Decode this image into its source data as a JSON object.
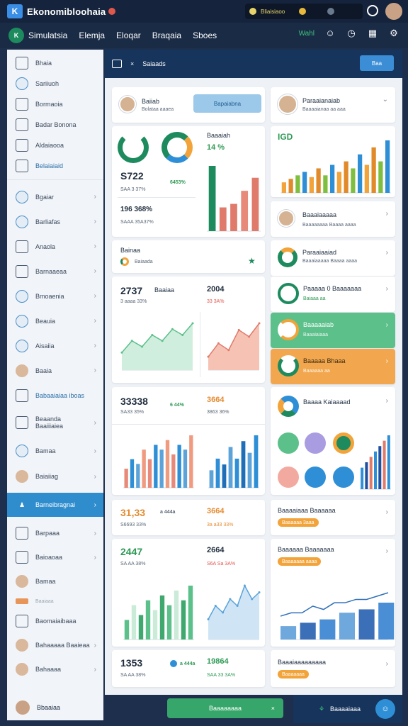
{
  "app": {
    "title": "Ekonomibloohaia",
    "status_text": "Bliaisiaoo"
  },
  "nav": {
    "logo_letter": "K",
    "items": [
      "Simulatsia",
      "Elemja",
      "Eloqar",
      "Braqaia",
      "Sboes"
    ],
    "right_label": "Wahl"
  },
  "sidebar": {
    "items": [
      {
        "label": "Bhaia",
        "icon": "chart-icon"
      },
      {
        "label": "Sariiuoh",
        "icon": "globe-icon"
      },
      {
        "label": "Bormaoia",
        "icon": "pen-icon"
      },
      {
        "label": "Badar Bonona",
        "icon": "document-icon"
      },
      {
        "label": "Aldaiaooa",
        "icon": "list-icon"
      },
      {
        "label": "Belaiaiaid",
        "icon": "table-icon"
      },
      {
        "label": "Bgaiar",
        "icon": "user-icon"
      },
      {
        "label": "Barliafas",
        "icon": "shield-icon"
      },
      {
        "label": "Anaola",
        "icon": "calendar-icon"
      },
      {
        "label": "Barnaaeaa",
        "icon": "chart-bar-icon"
      },
      {
        "label": "Bmoaenia",
        "icon": "globe-icon"
      },
      {
        "label": "Beauia",
        "icon": "home-icon"
      },
      {
        "label": "Aisaiia",
        "icon": "chat-icon"
      },
      {
        "label": "Baaia",
        "icon": "avatar-icon"
      },
      {
        "label": "Babaaiaiaa iboas",
        "icon": "mail-icon"
      },
      {
        "label": "Beaanda Baaiiiaiea",
        "icon": "document-icon"
      },
      {
        "label": "Bamaa",
        "icon": "bell-icon"
      },
      {
        "label": "Baiaiiag",
        "icon": "avatar-icon"
      },
      {
        "label": "Barneibragnai",
        "icon": "users-icon"
      },
      {
        "label": "Barpaaa",
        "icon": "building-icon"
      },
      {
        "label": "Baioaoaa",
        "icon": "document-icon"
      },
      {
        "label": "Bamaa",
        "icon": "avatar-icon"
      },
      {
        "label": "Baaiaaa",
        "icon": "folder-icon"
      },
      {
        "label": "Baomaiaibaaa",
        "icon": "table-icon"
      },
      {
        "label": "Bahaaaaa Baaieaa",
        "icon": "avatar-icon"
      },
      {
        "label": "Bahaaaa",
        "icon": "avatar-icon"
      }
    ],
    "footer_label": "Bbaaiaa"
  },
  "main": {
    "header_label": "Saiaads",
    "header_button": "Baa",
    "profile_top": {
      "name": "Baiiab",
      "sub": "Bolataa aaaea",
      "button": "Bapaiabna"
    },
    "profile_right": {
      "name": "Paraaianaiab",
      "sub": "Baaaaianaa aa aaa"
    },
    "kpi1": {
      "label": "Baaaiah",
      "pct": "14 %",
      "value": "S722",
      "change": "6453%",
      "sub1": "SAA 3 37%",
      "value2": "196 368%",
      "sub2": "SAAA 35A37%"
    },
    "chart_main_title": "IGD",
    "kpi2": {
      "label": "Bainaa",
      "sub": "Baiaada"
    },
    "list_a": {
      "title": "Baaaiaaaaa",
      "sub": "Baaaaaaaa Baaaa aaaa"
    },
    "list_b": {
      "title": "Paraaiaaiad",
      "sub": "Baaaiaaaaa Baaaa aaaa"
    },
    "card3": {
      "value": "2737",
      "label": "Baaiaa",
      "sub": "3 aaaa 33%",
      "value2": "2004",
      "sub2": "33 3A%"
    },
    "list_c": {
      "title": "Paaaaa 0 Baaaaaaa",
      "sub": "Baiaaa aa"
    },
    "list_d": {
      "title": "Baaaaaiab",
      "sub": "Baaaiaiaaa"
    },
    "list_e": {
      "title": "Baaaaa Bhaaa",
      "sub": "Baaaaaa aa"
    },
    "card4": {
      "value": "33338",
      "sub": "SA33 35%",
      "change": "6 44%",
      "value2": "3664",
      "sub2": "3863 36%"
    },
    "list_f": {
      "title": "Baaaa Kaiaaaad"
    },
    "card5": {
      "value": "31,33",
      "sub": "S6693 33%",
      "change": "a 444a",
      "value2": "3664",
      "sub2": "3a a33 33%"
    },
    "list_g": {
      "title": "Baaaaiaaa Baaaaaa",
      "pill": "Baaaaaa 3aaa"
    },
    "card6": {
      "value": "2447",
      "sub": "SA AA 38%",
      "value2": "2664",
      "sub2": "S6A Sa 3A%"
    },
    "list_h": {
      "title": "Baaaaaa Baaaaaaa",
      "pill": "Baaaaaaa aaaa"
    },
    "card7": {
      "value": "1353",
      "sub": "SA AA 38%",
      "change": "a 444a",
      "value2": "19864",
      "sub2": "SAA 33 3A%"
    },
    "list_i": {
      "title": "Baaaiaaaaaaaaa",
      "pill": "Baaaaaaa"
    }
  },
  "footer": {
    "button": "Baaaaaaaa",
    "right_label": "Baaaaiaaa"
  },
  "chart_data": [
    {
      "type": "bar",
      "values": [
        55,
        20,
        23,
        34,
        45
      ]
    },
    {
      "type": "bar",
      "values": [
        6,
        8,
        10,
        12,
        9,
        14,
        10,
        16,
        12,
        18,
        14,
        22,
        16,
        26,
        18,
        30
      ]
    },
    {
      "type": "area",
      "values": [
        3,
        5,
        4,
        6,
        5,
        7,
        6,
        8
      ]
    },
    {
      "type": "area",
      "values": [
        2,
        4,
        3,
        6,
        5,
        7
      ]
    },
    {
      "type": "bar",
      "values": [
        4,
        6,
        5,
        8,
        6,
        9,
        8,
        10,
        7,
        9,
        8,
        11
      ]
    },
    {
      "type": "bar",
      "values": [
        3,
        5,
        4,
        7,
        5,
        8,
        6,
        9
      ]
    },
    {
      "type": "bar",
      "values": [
        4,
        7,
        5,
        8,
        6,
        9,
        7,
        10,
        8,
        11
      ]
    },
    {
      "type": "area",
      "values": [
        3,
        5,
        4,
        6,
        5,
        8,
        6,
        7
      ]
    },
    {
      "type": "line",
      "values": [
        4,
        5,
        5,
        7,
        6,
        8,
        8,
        9,
        9,
        10,
        11
      ]
    },
    {
      "type": "bar",
      "values": [
        4,
        5,
        6,
        7,
        8,
        9,
        10
      ]
    }
  ]
}
